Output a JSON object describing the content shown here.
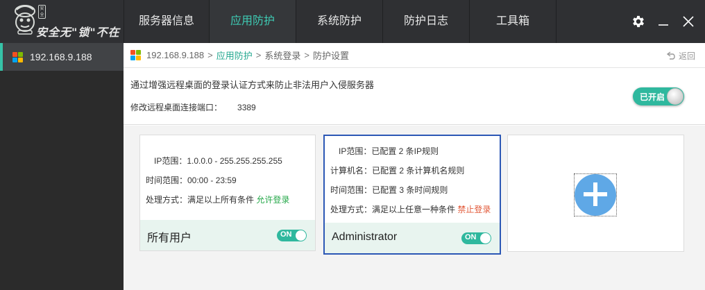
{
  "app": {
    "slogan": "安全无\"锁\"不在",
    "seal_text": "安全"
  },
  "nav": {
    "tabs": [
      {
        "label": "服务器信息"
      },
      {
        "label": "应用防护"
      },
      {
        "label": "系统防护"
      },
      {
        "label": "防护日志"
      },
      {
        "label": "工具箱"
      }
    ],
    "active_tab": "应用防护"
  },
  "sidebar": {
    "servers": [
      {
        "ip": "192.168.9.188"
      }
    ]
  },
  "breadcrumb": {
    "items": [
      "192.168.9.188",
      "应用防护",
      "系统登录",
      "防护设置"
    ],
    "separator": ">",
    "back_label": "返回"
  },
  "protection": {
    "description": "通过增强远程桌面的登录认证方式来防止非法用户入侵服务器",
    "port_label": "修改远程桌面连接端口：",
    "port_value": "3389",
    "status_label": "已开启"
  },
  "rules": [
    {
      "ip_range": "IP范围：1.0.0.0 - 255.255.255.255",
      "time_range": "时间范围：00:00 - 23:59",
      "action_prefix": "处理方式：满足以上所有条件",
      "action_result": "允许登录",
      "user": "所有用户",
      "toggle": "ON"
    },
    {
      "ip_range": "IP范围：已配置 2 条IP规则",
      "computer_name": "计算机名：已配置 2 条计算机名规则",
      "time_range": "时间范围：已配置 3 条时间规则",
      "action_prefix": "处理方式：满足以上任意一种条件",
      "action_result": "禁止登录",
      "user": "Administrator",
      "toggle": "ON"
    }
  ],
  "colors": {
    "accent": "#36c3a8",
    "allow": "#26a84a",
    "deny": "#e25a3a",
    "selected_border": "#2b57b5",
    "add_button": "#5fa8e6"
  }
}
